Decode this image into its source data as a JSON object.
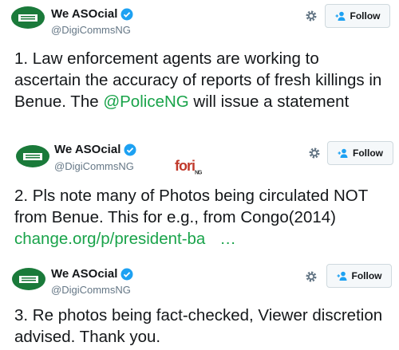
{
  "tweets": [
    {
      "name": "We ASOcial",
      "handle": "@DigiCommsNG",
      "follow_label": "Follow",
      "text_parts": {
        "before": "1. Law enforcement agents are working to ascertain the accuracy of reports of fresh killings in Benue. The ",
        "mention": "@PoliceNG",
        "after": " will issue a statement"
      }
    },
    {
      "name": "We ASOcial",
      "handle": "@DigiCommsNG",
      "follow_label": "Follow",
      "text_parts": {
        "before": "2. Pls note many of Photos being circulated NOT from Benue. This for e.g., from Congo(2014)",
        "link": "change.org/p/president-ba",
        "ellipsis": "…"
      }
    },
    {
      "name": "We ASOcial",
      "handle": "@DigiCommsNG",
      "follow_label": "Follow",
      "text_parts": {
        "before": "3. Re photos being fact-checked, Viewer discretion advised. Thank you."
      }
    }
  ],
  "watermark": {
    "text": "fori",
    "sub": "NG"
  },
  "colors": {
    "link": "#19a34a",
    "verified": "#1da1f2",
    "avatar": "#1a7a3a"
  },
  "icons": {
    "verified": "verified-badge-icon",
    "gear": "gear-icon",
    "follow": "add-user-icon"
  }
}
